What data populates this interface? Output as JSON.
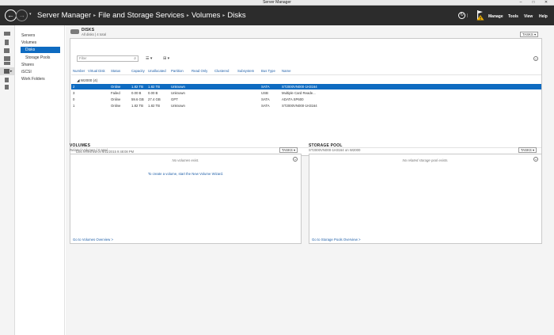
{
  "window": {
    "title": "Server Manager",
    "minimize": "–",
    "maximize": "□",
    "close": "✕"
  },
  "header": {
    "back_glyph": "←",
    "forward_glyph": "→",
    "dropdown_glyph": "▾",
    "breadcrumb": [
      "Server Manager",
      "File and Storage Services",
      "Volumes",
      "Disks"
    ],
    "separator": "▸",
    "refresh_glyph": "↻",
    "menus": [
      "Manage",
      "Tools",
      "View",
      "Help"
    ]
  },
  "sidebar": {
    "items": [
      {
        "label": "Servers"
      },
      {
        "label": "Volumes"
      },
      {
        "label": "Disks"
      },
      {
        "label": "Storage Pools"
      },
      {
        "label": "Shares"
      },
      {
        "label": "iSCSI"
      },
      {
        "label": "Work Folders"
      }
    ],
    "rail_arrow": "▸"
  },
  "disks": {
    "title": "DISKS",
    "subtitle": "All disks | 4 total",
    "tasks_label": "TASKS ▾",
    "filter_placeholder": "Filter",
    "search_glyph": "⌕",
    "list_options": "☰ ▾",
    "save_options": "⊞ ▾",
    "collapse_glyph": "⌄",
    "columns": [
      "Number",
      "Virtual Disk",
      "Status",
      "Capacity",
      "Unallocated",
      "Partition",
      "Read Only",
      "Clustered",
      "Subsystem",
      "Bus Type",
      "Name"
    ],
    "group": "◢  W2000 (4)",
    "rows": [
      [
        "2",
        "",
        "Online",
        "1.82 TB",
        "1.82 TB",
        "Unknown",
        "",
        "",
        "",
        "SATA",
        "ST2000VN000-1H3164"
      ],
      [
        "3",
        "",
        "Failed",
        "0.00 B",
        "0.00 B",
        "Unknown",
        "",
        "",
        "",
        "USB",
        "Multiple Card  Reade..."
      ],
      [
        "0",
        "",
        "Online",
        "59.6 GB",
        "27.4 GB",
        "GPT",
        "",
        "",
        "",
        "SATA",
        "ADATA SP600"
      ],
      [
        "1",
        "",
        "Online",
        "1.82 TB",
        "1.82 TB",
        "Unknown",
        "",
        "",
        "",
        "SATA",
        "ST2000VN000-1H3164"
      ]
    ],
    "last_refreshed": "Last refreshed on 6/11/2015 9:48:08 PM"
  },
  "volumes": {
    "title": "VOLUMES",
    "subtitle": "Related Volumes | 0 total",
    "tasks_label": "TASKS ▾",
    "empty": "No volumes exist.",
    "wizard_link": "To create a volume, start the New Volume Wizard.",
    "overview_link": "Go to Volumes Overview >"
  },
  "storage_pool": {
    "title": "STORAGE POOL",
    "subtitle": "ST2000VN000-1H3164 on W2000",
    "tasks_label": "TASKS ▾",
    "empty": "No related storage pool exists.",
    "overview_link": "Go to Storage Pools Overview >"
  },
  "colors": {
    "header_bg": "#2c2c2c",
    "selection": "#0e6bc1",
    "link": "#1f5fa8",
    "warning": "#f0b000"
  }
}
